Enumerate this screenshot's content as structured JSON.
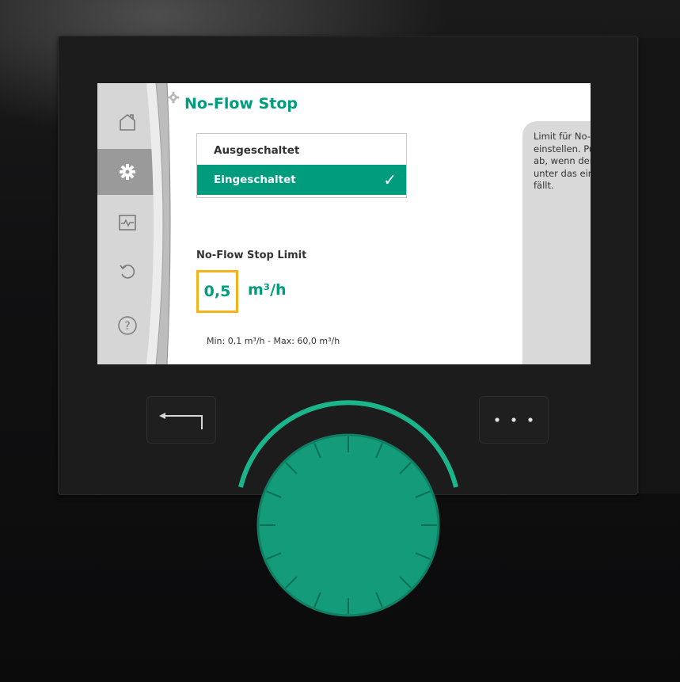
{
  "screen": {
    "title": "No-Flow Stop",
    "options": [
      {
        "label": "Ausgeschaltet",
        "selected": false
      },
      {
        "label": "Eingeschaltet",
        "selected": true
      }
    ],
    "check_mark": "✓",
    "limit_label": "No-Flow Stop Limit",
    "limit_value": "0,5",
    "limit_unit": "m³/h",
    "range_text": "Min: 0,1 m³/h - Max: 60,0 m³/h",
    "help_text": "Limit für No-Flow Stop einstellen. Pumpe schaltet ab, wenn der Durchfluss unter das eingestellte Limit fällt."
  },
  "nav": {
    "items": [
      {
        "icon": "home-icon",
        "active": false
      },
      {
        "icon": "gear-icon",
        "active": true
      },
      {
        "icon": "monitor-icon",
        "active": false
      },
      {
        "icon": "undo-icon",
        "active": false
      },
      {
        "icon": "help-icon",
        "active": false
      }
    ]
  },
  "hardware": {
    "back_button_icon": "back-arrow-icon",
    "more_button_icon": "more-dots-icon",
    "knob_icon": "rotary-knob"
  },
  "colors": {
    "accent": "#009c7e",
    "focus": "#f7b11a",
    "knob": "#139d79"
  }
}
